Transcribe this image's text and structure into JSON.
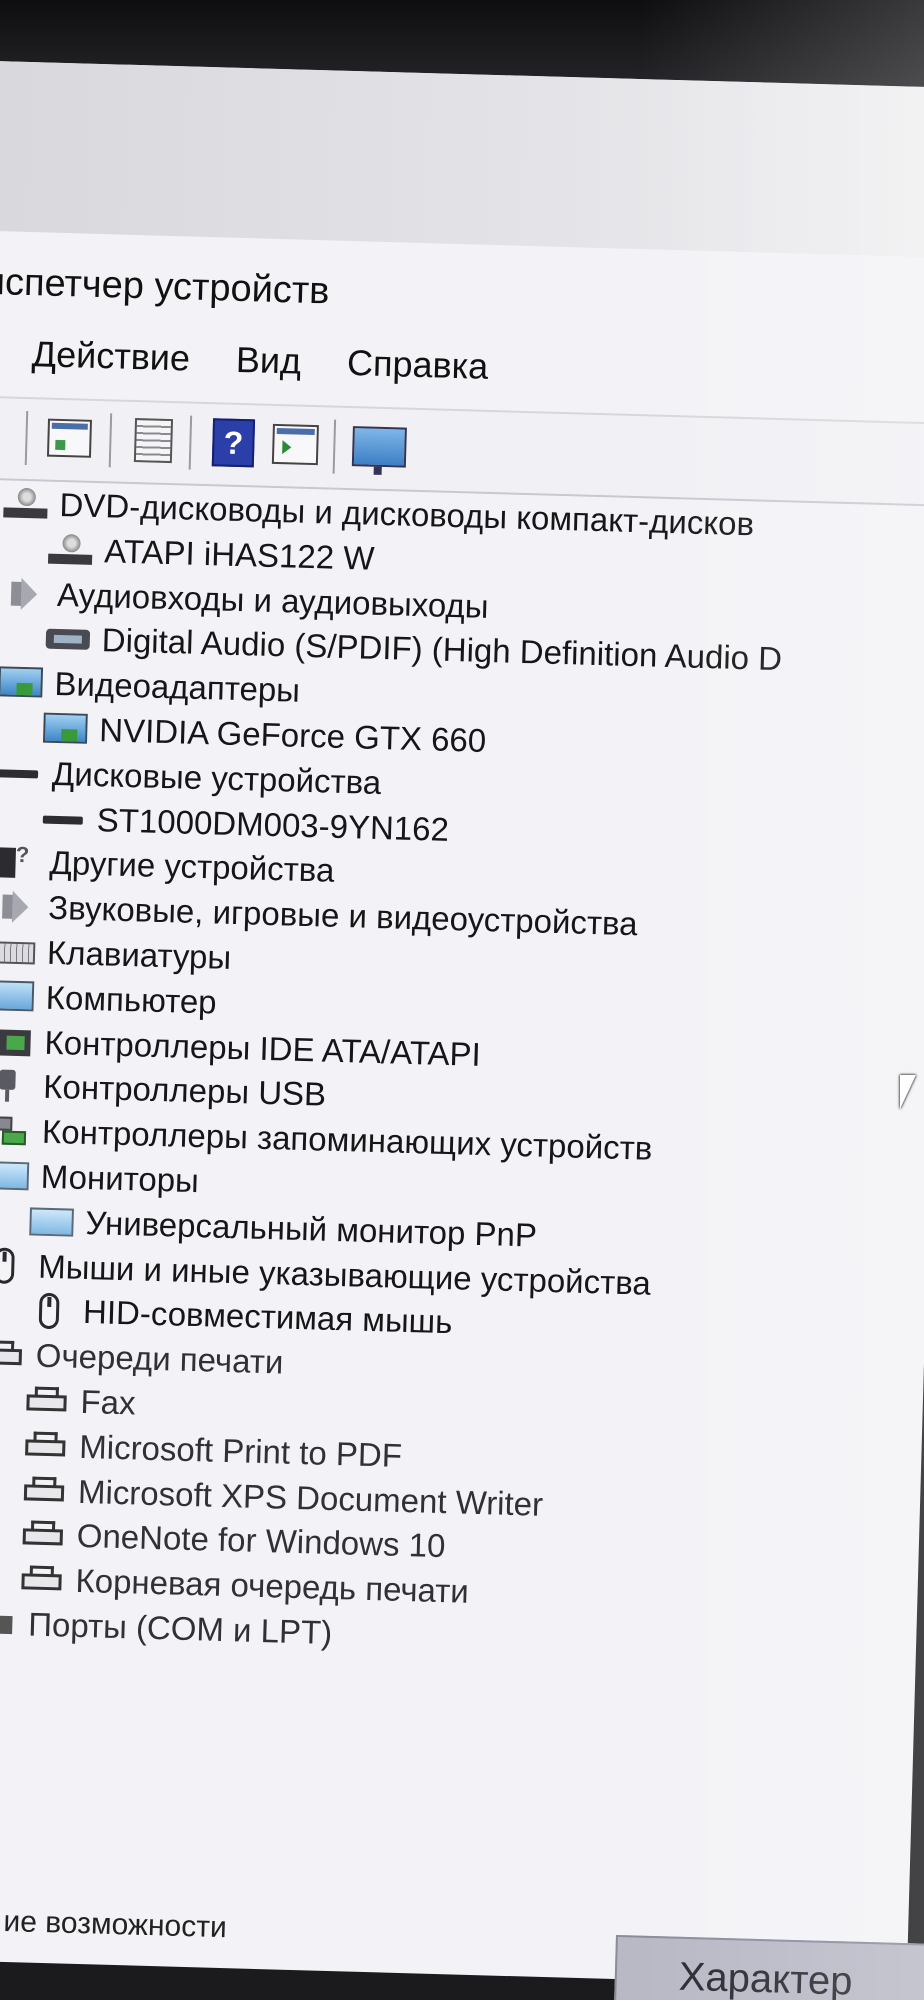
{
  "window": {
    "title": "испетчер устройств"
  },
  "menu": {
    "items": [
      "Действие",
      "Вид",
      "Справка"
    ]
  },
  "toolbar": {
    "buttons": [
      "back-arrow-icon",
      "properties-icon",
      "document-icon",
      "help-icon",
      "run-icon",
      "monitor-scan-icon"
    ]
  },
  "tree": {
    "items": [
      {
        "label": "DVD-дисководы и дисководы компакт-дисков",
        "level": 0,
        "icon": "disc-drive-icon",
        "expanded": true
      },
      {
        "label": "ATAPI iHAS122   W",
        "level": 1,
        "icon": "disc-drive-icon"
      },
      {
        "label": "Аудиовходы и аудиовыходы",
        "level": 0,
        "icon": "speaker-icon",
        "expanded": true
      },
      {
        "label": "Digital Audio (S/PDIF) (High Definition Audio D",
        "level": 1,
        "icon": "audio-device-icon"
      },
      {
        "label": "Видеоадаптеры",
        "level": 0,
        "icon": "display-adapter-icon",
        "expanded": true
      },
      {
        "label": "NVIDIA GeForce GTX 660",
        "level": 1,
        "icon": "display-adapter-icon"
      },
      {
        "label": "Дисковые устройства",
        "level": 0,
        "icon": "disk-drive-icon",
        "expanded": true
      },
      {
        "label": "ST1000DM003-9YN162",
        "level": 1,
        "icon": "disk-drive-icon"
      },
      {
        "label": "Другие устройства",
        "level": 0,
        "icon": "unknown-device-icon",
        "expanded": false
      },
      {
        "label": "Звуковые, игровые и видеоустройства",
        "level": 0,
        "icon": "speaker-icon",
        "expanded": false
      },
      {
        "label": "Клавиатуры",
        "level": 0,
        "icon": "keyboard-icon",
        "expanded": false
      },
      {
        "label": "Компьютер",
        "level": 0,
        "icon": "computer-icon",
        "expanded": false
      },
      {
        "label": "Контроллеры IDE ATA/ATAPI",
        "level": 0,
        "icon": "ide-controller-icon",
        "expanded": false
      },
      {
        "label": "Контроллеры USB",
        "level": 0,
        "icon": "usb-icon",
        "expanded": false
      },
      {
        "label": "Контроллеры запоминающих устройств",
        "level": 0,
        "icon": "storage-controller-icon",
        "expanded": false
      },
      {
        "label": "Мониторы",
        "level": 0,
        "icon": "monitor-icon",
        "expanded": true
      },
      {
        "label": "Универсальный монитор PnP",
        "level": 1,
        "icon": "monitor-icon"
      },
      {
        "label": "Мыши и иные указывающие устройства",
        "level": 0,
        "icon": "mouse-icon",
        "expanded": true
      },
      {
        "label": "HID-совместимая мышь",
        "level": 1,
        "icon": "mouse-icon"
      },
      {
        "label": "Очереди печати",
        "level": 0,
        "icon": "printer-icon",
        "expanded": true
      },
      {
        "label": "Fax",
        "level": 1,
        "icon": "printer-icon"
      },
      {
        "label": "Microsoft Print to PDF",
        "level": 1,
        "icon": "printer-icon"
      },
      {
        "label": "Microsoft XPS Document Writer",
        "level": 1,
        "icon": "printer-icon"
      },
      {
        "label": "OneNote for Windows 10",
        "level": 1,
        "icon": "printer-icon"
      },
      {
        "label": "Корневая очередь печати",
        "level": 1,
        "icon": "printer-icon"
      },
      {
        "label": "Порты (COM и LPT)",
        "level": 0,
        "icon": "port-icon",
        "expanded": false
      }
    ]
  },
  "footer": {
    "text": "ие возможности",
    "button_label": "Характер"
  }
}
